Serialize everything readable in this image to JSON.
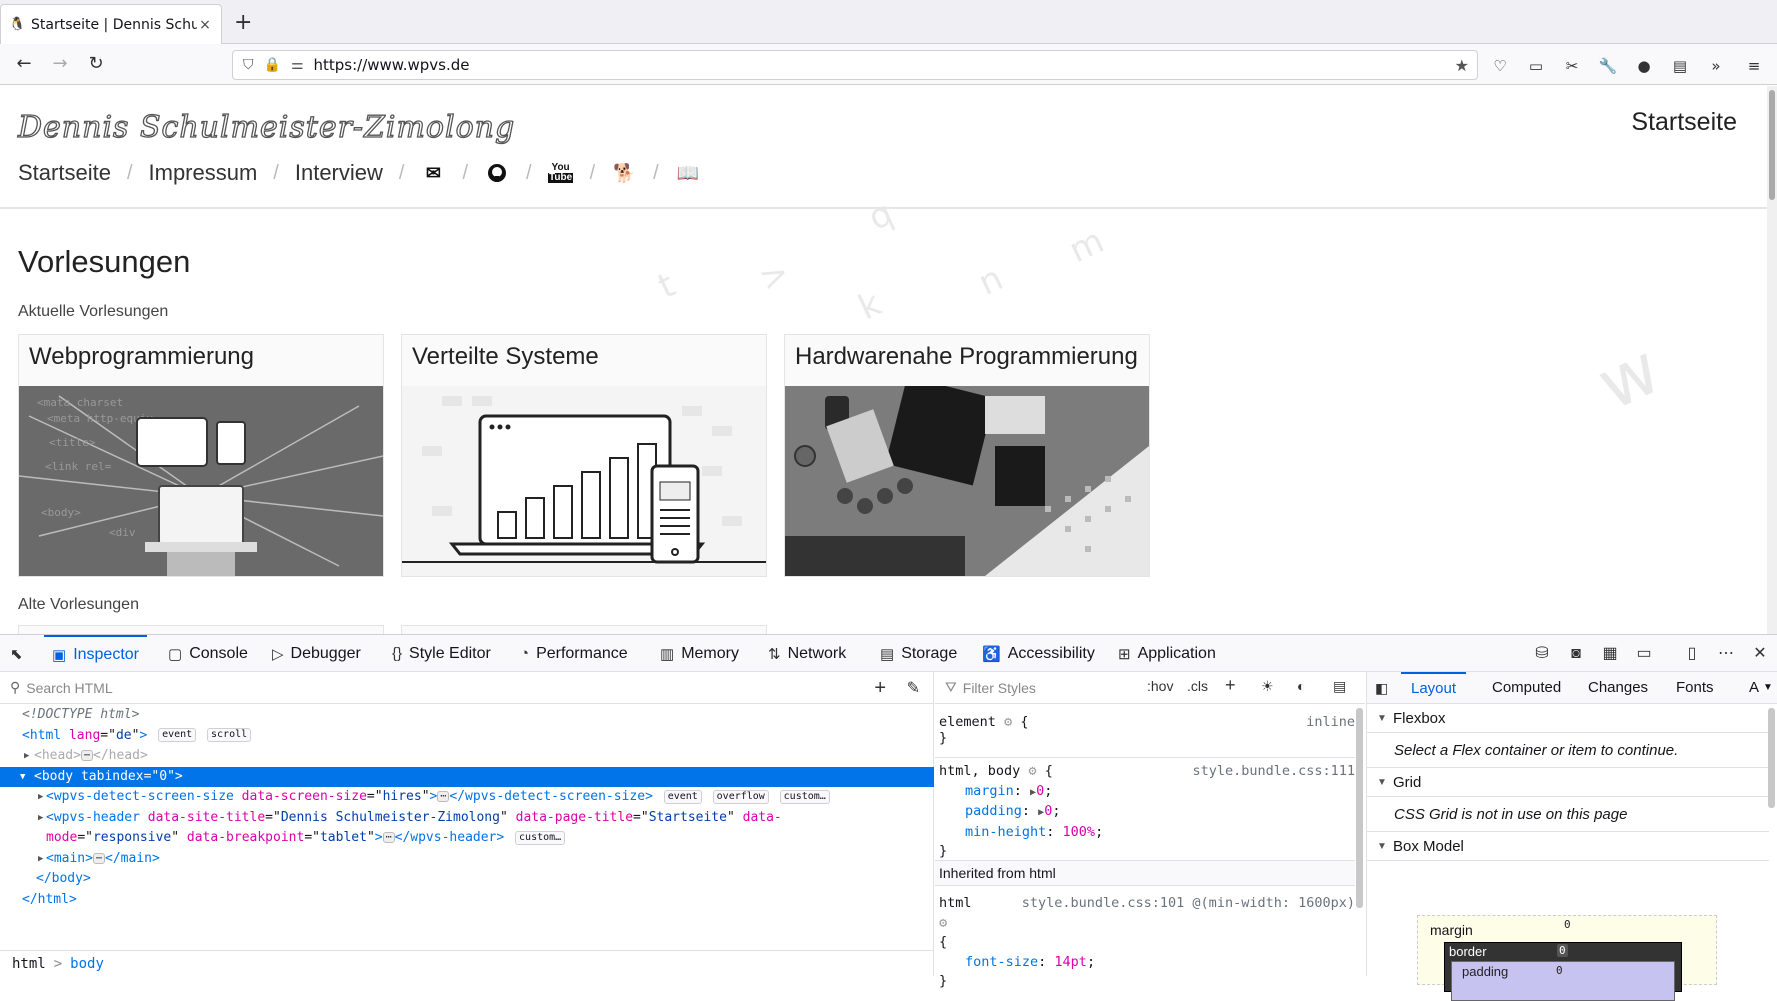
{
  "browser": {
    "tab_title": "Startseite | Dennis Schulm",
    "tab_close": "×",
    "new_tab": "+",
    "url": "https://www.wpvs.de"
  },
  "site": {
    "title": "Dennis Schulmeister-Zimolong",
    "page_label": "Startseite",
    "nav": [
      {
        "label": "Startseite"
      },
      {
        "label": "Impressum"
      },
      {
        "label": "Interview"
      }
    ],
    "nav_icons": [
      "envelope-icon",
      "github-icon",
      "youtube-icon",
      "dog-icon",
      "book-icon"
    ],
    "heading": "Vorlesungen",
    "current_label": "Aktuelle Vorlesungen",
    "old_label": "Alte Vorlesungen",
    "cards": [
      {
        "title": "Webprogrammierung"
      },
      {
        "title": "Verteilte Systeme"
      },
      {
        "title": "Hardwarenahe Programmierung"
      }
    ]
  },
  "devtools": {
    "tabs": [
      "Inspector",
      "Console",
      "Debugger",
      "Style Editor",
      "Performance",
      "Memory",
      "Network",
      "Storage",
      "Accessibility",
      "Application"
    ],
    "active_tab": "Inspector",
    "search_placeholder": "Search HTML",
    "filter_placeholder": "Filter Styles",
    "hov": ":hov",
    "cls": ".cls",
    "markup": {
      "doctype": "<!DOCTYPE html>",
      "html_open": "html",
      "lang_attr": "lang",
      "lang_val": "de",
      "head": "head",
      "body_attr": "tabindex",
      "body_val": "0",
      "detect_tag": "wpvs-detect-screen-size",
      "detect_attr": "data-screen-size",
      "detect_val": "hires",
      "header_tag": "wpvs-header",
      "header_attr1": "data-site-title",
      "header_val1": "Dennis Schulmeister-Zimolong",
      "header_attr2": "data-page-title",
      "header_val2": "Startseite",
      "header_attr3a": "data-",
      "header_attr3b": "mode",
      "header_val3": "responsive",
      "header_attr4": "data-breakpoint",
      "header_val4": "tablet",
      "main_tag": "main",
      "body_close": "body",
      "html_close": "html",
      "badges": {
        "event": "event",
        "scroll": "scroll",
        "overflow": "overflow",
        "custom": "custom…"
      }
    },
    "breadcrumbs": [
      "html",
      "body"
    ],
    "rules": {
      "element_selector": "element",
      "element_src": "inline",
      "rule1_selector": "html, body",
      "rule1_src": "style.bundle.css:111",
      "rule1_props": [
        {
          "name": "margin",
          "value": "0"
        },
        {
          "name": "padding",
          "value": "0"
        },
        {
          "name": "min-height",
          "value": "100%"
        }
      ],
      "inherited_header": "Inherited from html",
      "rule2_selector": "html",
      "rule2_src": "style.bundle.css:101 @(min-width: 1600px)",
      "rule2_props": [
        {
          "name": "font-size",
          "value": "14pt"
        }
      ]
    },
    "layout": {
      "tabs": [
        "Layout",
        "Computed",
        "Changes",
        "Fonts",
        "A"
      ],
      "active_tab": "Layout",
      "flexbox": "Flexbox",
      "flexbox_note": "Select a Flex container or item to continue.",
      "grid": "Grid",
      "grid_note": "CSS Grid is not in use on this page",
      "boxmodel": "Box Model",
      "bm_margin": "margin",
      "bm_border": "border",
      "bm_padding": "padding",
      "bm_margin_val": "0",
      "bm_border_val": "0",
      "bm_padding_val": "0"
    }
  }
}
